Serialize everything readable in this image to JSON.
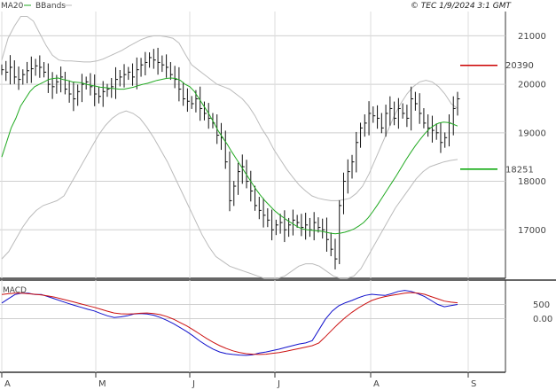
{
  "chart_data": [
    {
      "type": "line",
      "name": "price",
      "legend": [
        {
          "label": "MA20",
          "color": "#22aa22"
        },
        {
          "label": "BBands",
          "color": "#bbbbbb"
        }
      ],
      "timestamp": "© TEC 1/9/2024 3:1 GMT",
      "x_ticks": [
        "A",
        "M",
        "J",
        "J",
        "A",
        "S"
      ],
      "y_ticks": [
        "21000",
        "20000",
        "19000",
        "18000",
        "17000"
      ],
      "ylim": [
        16000,
        21500
      ],
      "grid": true,
      "resistance": {
        "label": "20390",
        "value": 20390,
        "color": "#cc0000"
      },
      "support": {
        "label": "18251",
        "value": 18251,
        "color": "#11aa11"
      },
      "close": [
        20300,
        20250,
        20350,
        20150,
        20100,
        20200,
        20280,
        20320,
        20380,
        20350,
        20250,
        20000,
        19950,
        20050,
        20150,
        19900,
        19800,
        19700,
        19850,
        20000,
        20050,
        19950,
        19800,
        19750,
        19850,
        19900,
        19950,
        20100,
        20150,
        20200,
        20250,
        20150,
        20300,
        20400,
        20450,
        20550,
        20500,
        20450,
        20400,
        20350,
        20200,
        20100,
        19900,
        19700,
        19650,
        19600,
        19700,
        19500,
        19400,
        19300,
        19200,
        18950,
        18900,
        18400,
        17600,
        17900,
        18200,
        18300,
        18000,
        17800,
        17500,
        17400,
        17300,
        17200,
        17000,
        17100,
        17150,
        17000,
        17100,
        17200,
        17150,
        17050,
        17100,
        17000,
        17150,
        17050,
        17000,
        16800,
        16600,
        16400,
        17500,
        18000,
        18200,
        18400,
        18800,
        19100,
        19200,
        19400,
        19350,
        19300,
        19100,
        19400,
        19500,
        19300,
        19500,
        19400,
        19300,
        19700,
        19600,
        19400,
        19200,
        19100,
        19050,
        19000,
        18800,
        18900,
        19200,
        19500,
        19700
      ],
      "ma20": [
        18500,
        18800,
        19100,
        19300,
        19550,
        19700,
        19850,
        19950,
        20000,
        20050,
        20100,
        20120,
        20130,
        20100,
        20080,
        20050,
        20040,
        20030,
        20000,
        19980,
        19960,
        19940,
        19930,
        19920,
        19910,
        19900,
        19900,
        19920,
        19940,
        19970,
        20000,
        20020,
        20050,
        20080,
        20100,
        20120,
        20130,
        20120,
        20080,
        20000,
        19950,
        19850,
        19700,
        19550,
        19400,
        19230,
        19050,
        18900,
        18760,
        18600,
        18450,
        18300,
        18150,
        18000,
        17850,
        17720,
        17600,
        17500,
        17400,
        17320,
        17250,
        17180,
        17120,
        17060,
        17020,
        17000,
        16990,
        16980,
        16970,
        16950,
        16930,
        16920,
        16930,
        16950,
        16980,
        17020,
        17080,
        17150,
        17250,
        17380,
        17520,
        17670,
        17820,
        17970,
        18120,
        18280,
        18440,
        18590,
        18730,
        18860,
        18980,
        19080,
        19150,
        19200,
        19220,
        19210,
        19180,
        19140
      ],
      "bb_upper": [
        20500,
        20950,
        21200,
        21400,
        21400,
        21300,
        21050,
        20800,
        20600,
        20500,
        20480,
        20480,
        20470,
        20460,
        20460,
        20480,
        20520,
        20580,
        20640,
        20700,
        20780,
        20850,
        20920,
        20970,
        21000,
        21000,
        20980,
        20950,
        20850,
        20620,
        20400,
        20300,
        20200,
        20100,
        20000,
        19950,
        19900,
        19800,
        19700,
        19550,
        19350,
        19100,
        18900,
        18650,
        18450,
        18250,
        18080,
        17920,
        17800,
        17700,
        17650,
        17620,
        17600,
        17600,
        17620,
        17650,
        17750,
        17900,
        18150,
        18450,
        18750,
        19050,
        19350,
        19600,
        19800,
        19950,
        20050,
        20080,
        20050,
        19950,
        19800,
        19600,
        19500
      ],
      "bb_lower": [
        16400,
        16550,
        16800,
        17050,
        17250,
        17400,
        17500,
        17550,
        17600,
        17700,
        17950,
        18200,
        18450,
        18700,
        18950,
        19150,
        19300,
        19400,
        19450,
        19400,
        19300,
        19120,
        18900,
        18650,
        18400,
        18100,
        17800,
        17500,
        17200,
        16900,
        16650,
        16450,
        16350,
        16250,
        16200,
        16150,
        16100,
        16050,
        16000,
        16000,
        16000,
        16050,
        16150,
        16250,
        16300,
        16300,
        16250,
        16150,
        16050,
        16000,
        16000,
        16050,
        16200,
        16450,
        16700,
        16950,
        17200,
        17450,
        17650,
        17850,
        18050,
        18200,
        18300,
        18350,
        18400,
        18430,
        18450
      ]
    },
    {
      "type": "line",
      "name": "macd",
      "title": "MACD",
      "y_ticks": [
        "500",
        "0.00"
      ],
      "ylim": [
        -1900,
        1300
      ],
      "x_ticks": [
        "A",
        "M",
        "J",
        "J",
        "A",
        "S"
      ],
      "series": [
        {
          "color": "#1111cc",
          "values": [
            550,
            700,
            850,
            900,
            900,
            850,
            850,
            780,
            700,
            620,
            540,
            470,
            400,
            330,
            270,
            180,
            100,
            40,
            60,
            100,
            160,
            180,
            160,
            120,
            40,
            -60,
            -180,
            -320,
            -460,
            -620,
            -800,
            -950,
            -1080,
            -1180,
            -1240,
            -1270,
            -1290,
            -1300,
            -1280,
            -1220,
            -1180,
            -1130,
            -1080,
            -1020,
            -960,
            -900,
            -860,
            -780,
            -400,
            -20,
            260,
            450,
            560,
            640,
            740,
            820,
            860,
            840,
            820,
            880,
            960,
            1000,
            960,
            880,
            780,
            640,
            500,
            420,
            460,
            500
          ]
        },
        {
          "color": "#cc1111",
          "values": [
            850,
            880,
            900,
            900,
            880,
            860,
            840,
            800,
            760,
            700,
            640,
            580,
            520,
            460,
            400,
            330,
            260,
            200,
            170,
            160,
            170,
            190,
            200,
            180,
            140,
            70,
            -20,
            -140,
            -260,
            -400,
            -550,
            -700,
            -840,
            -960,
            -1060,
            -1140,
            -1200,
            -1240,
            -1260,
            -1270,
            -1260,
            -1230,
            -1200,
            -1160,
            -1110,
            -1060,
            -1010,
            -960,
            -860,
            -640,
            -400,
            -170,
            40,
            220,
            380,
            520,
            640,
            720,
            780,
            820,
            860,
            900,
            920,
            900,
            860,
            780,
            700,
            620,
            580,
            560
          ]
        }
      ]
    }
  ]
}
